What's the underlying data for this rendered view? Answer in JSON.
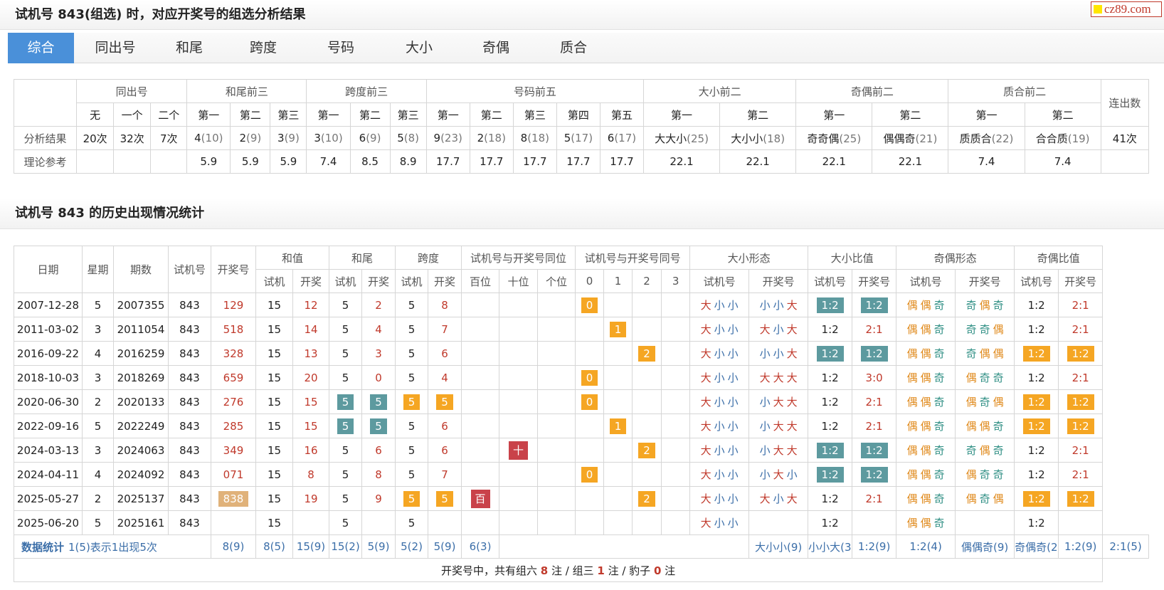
{
  "header": {
    "title": "试机号 843(组选) 时，对应开奖号的组选分析结果",
    "logo_text": "cz89.com"
  },
  "tabs": [
    "综合",
    "同出号",
    "和尾",
    "跨度",
    "号码",
    "大小",
    "奇偶",
    "质合"
  ],
  "active_tab": "综合",
  "analysis": {
    "groups": [
      "同出号",
      "和尾前三",
      "跨度前三",
      "号码前五",
      "大小前二",
      "奇偶前二",
      "质合前二",
      "连出数"
    ],
    "subheaders": [
      "无",
      "一个",
      "二个",
      "第一",
      "第二",
      "第三",
      "第一",
      "第二",
      "第三",
      "第一",
      "第二",
      "第三",
      "第四",
      "第五",
      "第一",
      "第二",
      "第一",
      "第二",
      "第一",
      "第二"
    ],
    "rows": [
      {
        "label": "分析结果",
        "cells": [
          [
            "20次",
            ""
          ],
          [
            "32次",
            ""
          ],
          [
            "7次",
            ""
          ],
          [
            "4",
            "(10)"
          ],
          [
            "2",
            "(9)"
          ],
          [
            "3",
            "(9)"
          ],
          [
            "3",
            "(10)"
          ],
          [
            "6",
            "(9)"
          ],
          [
            "5",
            "(8)"
          ],
          [
            "9",
            "(23)"
          ],
          [
            "2",
            "(18)"
          ],
          [
            "8",
            "(18)"
          ],
          [
            "5",
            "(17)"
          ],
          [
            "6",
            "(17)"
          ],
          [
            "大大小",
            "(25)"
          ],
          [
            "大小小",
            "(18)"
          ],
          [
            "奇奇偶",
            "(25)"
          ],
          [
            "偶偶奇",
            "(21)"
          ],
          [
            "质质合",
            "(22)"
          ],
          [
            "合合质",
            "(19)"
          ],
          [
            "41次",
            ""
          ]
        ]
      },
      {
        "label": "理论参考",
        "cells": [
          [
            "",
            ""
          ],
          [
            "",
            ""
          ],
          [
            "",
            ""
          ],
          [
            "5.9",
            ""
          ],
          [
            "5.9",
            ""
          ],
          [
            "5.9",
            ""
          ],
          [
            "7.4",
            ""
          ],
          [
            "8.5",
            ""
          ],
          [
            "8.9",
            ""
          ],
          [
            "17.7",
            ""
          ],
          [
            "17.7",
            ""
          ],
          [
            "17.7",
            ""
          ],
          [
            "17.7",
            ""
          ],
          [
            "17.7",
            ""
          ],
          [
            "22.1",
            ""
          ],
          [
            "22.1",
            ""
          ],
          [
            "22.1",
            ""
          ],
          [
            "22.1",
            ""
          ],
          [
            "7.4",
            ""
          ],
          [
            "7.4",
            ""
          ],
          [
            "",
            ""
          ]
        ]
      }
    ]
  },
  "history": {
    "title": "试机号 843 的历史出现情况统计",
    "groups": [
      "日期",
      "星期",
      "期数",
      "试机号",
      "开奖号",
      "和值",
      "和尾",
      "跨度",
      "试机号与开奖号同位",
      "试机号与开奖号同号",
      "大小形态",
      "大小比值",
      "奇偶形态",
      "奇偶比值"
    ],
    "sub": [
      "试机",
      "开奖",
      "试机",
      "开奖",
      "试机",
      "开奖",
      "百位",
      "十位",
      "个位",
      "0",
      "1",
      "2",
      "3",
      "试机号",
      "开奖号",
      "试机号",
      "开奖号",
      "试机号",
      "开奖号",
      "试机号",
      "开奖号"
    ],
    "rows": [
      {
        "date": "2007-12-28",
        "week": "5",
        "issue": "2007355",
        "test": "843",
        "draw": "129",
        "draw_tag": "",
        "sum_t": "15",
        "sum_d": "12",
        "tail_t": "5",
        "tail_d": "2",
        "tail_hl": false,
        "span_t": "5",
        "span_d": "8",
        "span_hl": false,
        "pos": [
          "",
          "",
          ""
        ],
        "same": [
          "0",
          "",
          "",
          ""
        ],
        "bs_t": "大小小",
        "bs_d": "小小大",
        "bsr_t": "1:2",
        "bsr_t_tag": "teal",
        "bsr_d": "1:2",
        "bsr_d_tag": "teal",
        "oe_t": "偶偶奇",
        "oe_d": "奇偶奇",
        "oer_t": "1:2",
        "oer_t_tag": "",
        "oer_d": "2:1",
        "oer_d_tag": ""
      },
      {
        "date": "2011-03-02",
        "week": "3",
        "issue": "2011054",
        "test": "843",
        "draw": "518",
        "draw_tag": "",
        "sum_t": "15",
        "sum_d": "14",
        "tail_t": "5",
        "tail_d": "4",
        "tail_hl": false,
        "span_t": "5",
        "span_d": "7",
        "span_hl": false,
        "pos": [
          "",
          "",
          ""
        ],
        "same": [
          "",
          "1",
          "",
          ""
        ],
        "bs_t": "大小小",
        "bs_d": "大小大",
        "bsr_t": "1:2",
        "bsr_t_tag": "",
        "bsr_d": "2:1",
        "bsr_d_tag": "",
        "oe_t": "偶偶奇",
        "oe_d": "奇奇偶",
        "oer_t": "1:2",
        "oer_t_tag": "",
        "oer_d": "2:1",
        "oer_d_tag": ""
      },
      {
        "date": "2016-09-22",
        "week": "4",
        "issue": "2016259",
        "test": "843",
        "draw": "328",
        "draw_tag": "",
        "sum_t": "15",
        "sum_d": "13",
        "tail_t": "5",
        "tail_d": "3",
        "tail_hl": false,
        "span_t": "5",
        "span_d": "6",
        "span_hl": false,
        "pos": [
          "",
          "",
          ""
        ],
        "same": [
          "",
          "",
          "2",
          ""
        ],
        "bs_t": "大小小",
        "bs_d": "小小大",
        "bsr_t": "1:2",
        "bsr_t_tag": "teal",
        "bsr_d": "1:2",
        "bsr_d_tag": "teal",
        "oe_t": "偶偶奇",
        "oe_d": "奇偶偶",
        "oer_t": "1:2",
        "oer_t_tag": "orange",
        "oer_d": "1:2",
        "oer_d_tag": "orange"
      },
      {
        "date": "2018-10-03",
        "week": "3",
        "issue": "2018269",
        "test": "843",
        "draw": "659",
        "draw_tag": "",
        "sum_t": "15",
        "sum_d": "20",
        "tail_t": "5",
        "tail_d": "0",
        "tail_hl": false,
        "span_t": "5",
        "span_d": "4",
        "span_hl": false,
        "pos": [
          "",
          "",
          ""
        ],
        "same": [
          "0",
          "",
          "",
          ""
        ],
        "bs_t": "大小小",
        "bs_d": "大大大",
        "bsr_t": "1:2",
        "bsr_t_tag": "",
        "bsr_d": "3:0",
        "bsr_d_tag": "",
        "oe_t": "偶偶奇",
        "oe_d": "偶奇奇",
        "oer_t": "1:2",
        "oer_t_tag": "",
        "oer_d": "2:1",
        "oer_d_tag": ""
      },
      {
        "date": "2020-06-30",
        "week": "2",
        "issue": "2020133",
        "test": "843",
        "draw": "276",
        "draw_tag": "",
        "sum_t": "15",
        "sum_d": "15",
        "tail_t": "5",
        "tail_d": "5",
        "tail_hl": true,
        "span_t": "5",
        "span_d": "5",
        "span_hl": true,
        "pos": [
          "",
          "",
          ""
        ],
        "same": [
          "0",
          "",
          "",
          ""
        ],
        "bs_t": "大小小",
        "bs_d": "小大大",
        "bsr_t": "1:2",
        "bsr_t_tag": "",
        "bsr_d": "2:1",
        "bsr_d_tag": "",
        "oe_t": "偶偶奇",
        "oe_d": "偶奇偶",
        "oer_t": "1:2",
        "oer_t_tag": "orange",
        "oer_d": "1:2",
        "oer_d_tag": "orange"
      },
      {
        "date": "2022-09-16",
        "week": "5",
        "issue": "2022249",
        "test": "843",
        "draw": "285",
        "draw_tag": "",
        "sum_t": "15",
        "sum_d": "15",
        "tail_t": "5",
        "tail_d": "5",
        "tail_hl": true,
        "span_t": "5",
        "span_d": "6",
        "span_hl": false,
        "pos": [
          "",
          "",
          ""
        ],
        "same": [
          "",
          "1",
          "",
          ""
        ],
        "bs_t": "大小小",
        "bs_d": "小大大",
        "bsr_t": "1:2",
        "bsr_t_tag": "",
        "bsr_d": "2:1",
        "bsr_d_tag": "",
        "oe_t": "偶偶奇",
        "oe_d": "偶偶奇",
        "oer_t": "1:2",
        "oer_t_tag": "orange",
        "oer_d": "1:2",
        "oer_d_tag": "orange"
      },
      {
        "date": "2024-03-13",
        "week": "3",
        "issue": "2024063",
        "test": "843",
        "draw": "349",
        "draw_tag": "",
        "sum_t": "15",
        "sum_d": "16",
        "tail_t": "5",
        "tail_d": "6",
        "tail_hl": false,
        "span_t": "5",
        "span_d": "6",
        "span_hl": false,
        "pos": [
          "",
          "十",
          ""
        ],
        "same": [
          "",
          "",
          "2",
          ""
        ],
        "bs_t": "大小小",
        "bs_d": "小大大",
        "bsr_t": "1:2",
        "bsr_t_tag": "teal",
        "bsr_d": "1:2",
        "bsr_d_tag": "teal",
        "oe_t": "偶偶奇",
        "oe_d": "奇偶奇",
        "oer_t": "1:2",
        "oer_t_tag": "",
        "oer_d": "2:1",
        "oer_d_tag": ""
      },
      {
        "date": "2024-04-11",
        "week": "4",
        "issue": "2024092",
        "test": "843",
        "draw": "071",
        "draw_tag": "",
        "sum_t": "15",
        "sum_d": "8",
        "tail_t": "5",
        "tail_d": "8",
        "tail_hl": false,
        "span_t": "5",
        "span_d": "7",
        "span_hl": false,
        "pos": [
          "",
          "",
          ""
        ],
        "same": [
          "0",
          "",
          "",
          ""
        ],
        "bs_t": "大小小",
        "bs_d": "小大小",
        "bsr_t": "1:2",
        "bsr_t_tag": "teal",
        "bsr_d": "1:2",
        "bsr_d_tag": "teal",
        "oe_t": "偶偶奇",
        "oe_d": "偶奇奇",
        "oer_t": "1:2",
        "oer_t_tag": "",
        "oer_d": "2:1",
        "oer_d_tag": ""
      },
      {
        "date": "2025-05-27",
        "week": "2",
        "issue": "2025137",
        "test": "843",
        "draw": "838",
        "draw_tag": "tan",
        "sum_t": "15",
        "sum_d": "19",
        "tail_t": "5",
        "tail_d": "9",
        "tail_hl": false,
        "span_t": "5",
        "span_d": "5",
        "span_hl": true,
        "pos": [
          "百",
          "",
          ""
        ],
        "same": [
          "",
          "",
          "2",
          ""
        ],
        "bs_t": "大小小",
        "bs_d": "大小大",
        "bsr_t": "1:2",
        "bsr_t_tag": "",
        "bsr_d": "2:1",
        "bsr_d_tag": "",
        "oe_t": "偶偶奇",
        "oe_d": "偶奇偶",
        "oer_t": "1:2",
        "oer_t_tag": "orange",
        "oer_d": "1:2",
        "oer_d_tag": "orange"
      },
      {
        "date": "2025-06-20",
        "week": "5",
        "issue": "2025161",
        "test": "843",
        "draw": "",
        "draw_tag": "",
        "sum_t": "15",
        "sum_d": "",
        "tail_t": "5",
        "tail_d": "",
        "tail_hl": false,
        "span_t": "5",
        "span_d": "",
        "span_hl": false,
        "pos": [
          "",
          "",
          ""
        ],
        "same": [
          "",
          "",
          "",
          ""
        ],
        "bs_t": "大小小",
        "bs_d": "",
        "bsr_t": "1:2",
        "bsr_t_tag": "",
        "bsr_d": "",
        "bsr_d_tag": "",
        "oe_t": "偶偶奇",
        "oe_d": "",
        "oer_t": "1:2",
        "oer_t_tag": "",
        "oer_d": "",
        "oer_d_tag": ""
      }
    ],
    "summary": {
      "label": "数据统计",
      "note": "1(5)表示1出现5次",
      "cells": [
        "8(9)",
        "8(5)",
        "15(9)",
        "15(2)",
        "5(9)",
        "5(2)",
        "5(9)",
        "6(3)",
        "大小小(9)",
        "小小大(3)",
        "1:2(9)",
        "1:2(4)",
        "偶偶奇(9)",
        "奇偶奇(2)",
        "1:2(9)",
        "2:1(5)"
      ]
    },
    "footer": {
      "p1": "开奖号中，共有组六 ",
      "n1": "8",
      "p2": " 注 / 组三 ",
      "n2": "1",
      "p3": " 注 / 豹子 ",
      "n3": "0",
      "p4": " 注"
    }
  },
  "colors": {
    "teal": "#5d9a9f",
    "orange": "#f5a623",
    "tan": "#e0b27a",
    "red": "#c9424a",
    "tab_active": "#4a90d9"
  }
}
